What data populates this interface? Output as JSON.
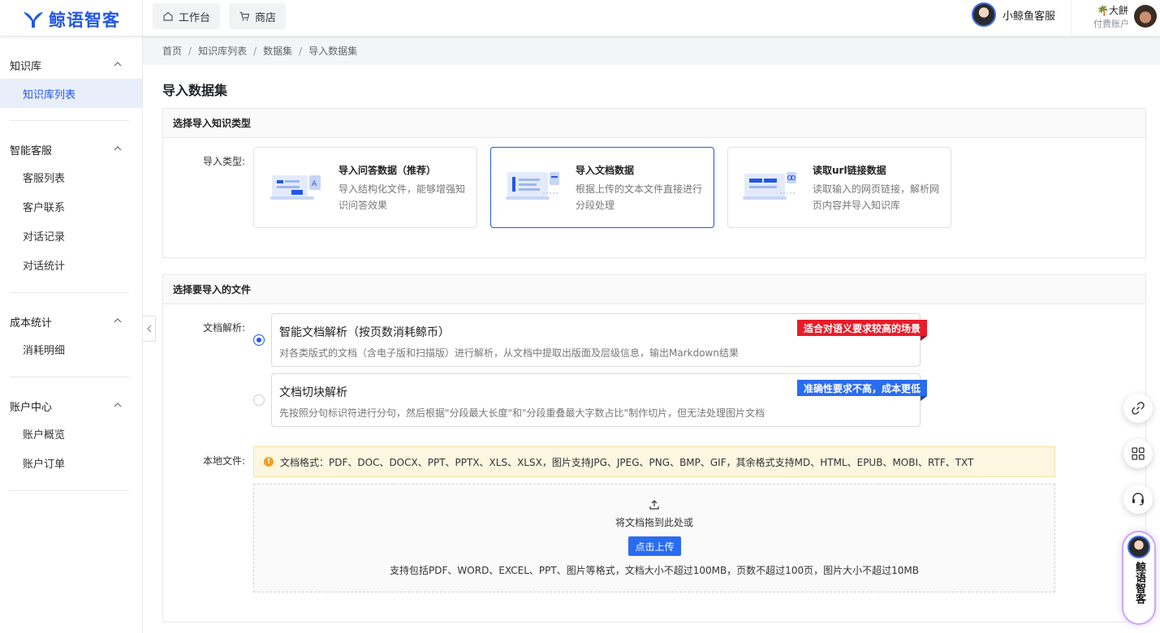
{
  "header": {
    "logo_text": "鲸语智客",
    "nav": [
      {
        "label": "工作台",
        "icon": "home-icon"
      },
      {
        "label": "商店",
        "icon": "cart-icon"
      }
    ],
    "customer_service": "小鲸鱼客服",
    "user": {
      "name": "🌴大餅",
      "tier": "付费账户"
    }
  },
  "sidebar": {
    "sections": [
      {
        "title": "知识库",
        "items": [
          "知识库列表"
        ]
      },
      {
        "title": "智能客服",
        "items": [
          "客服列表",
          "客户联系",
          "对话记录",
          "对话统计"
        ]
      },
      {
        "title": "成本统计",
        "items": [
          "消耗明细"
        ]
      },
      {
        "title": "账户中心",
        "items": [
          "账户概览",
          "账户订单"
        ]
      }
    ],
    "active_item": "知识库列表"
  },
  "breadcrumb": [
    "首页",
    "知识库列表",
    "数据集",
    "导入数据集"
  ],
  "page_title": "导入数据集",
  "import_type": {
    "section_title": "选择导入知识类型",
    "label": "导入类型:",
    "cards": [
      {
        "title": "导入问答数据（推荐）",
        "desc": "导入结构化文件，能够增强知识问答效果",
        "icon": "qa-data-icon",
        "selected": false
      },
      {
        "title": "导入文档数据",
        "desc": "根据上传的文本文件直接进行分段处理",
        "icon": "document-data-icon",
        "selected": true
      },
      {
        "title": "读取url链接数据",
        "desc": "读取输入的网页链接，解析网页内容并导入知识库",
        "icon": "url-link-icon",
        "selected": false
      }
    ]
  },
  "file_section": {
    "section_title": "选择要导入的文件",
    "parse_label": "文档解析:",
    "options": [
      {
        "title": "智能文档解析（按页数消耗鲸币）",
        "desc": "对各类版式的文档（含电子版和扫描版）进行解析，从文档中提取出版面及层级信息，输出Markdown结果",
        "tag": "适合对语义要求较高的场景",
        "tag_color": "#e81c2a",
        "selected": true
      },
      {
        "title": "文档切块解析",
        "desc": "先按照分句标识符进行分句，然后根据\"分段最大长度\"和\"分段重叠最大字数占比\"制作切片，但无法处理图片文档",
        "tag": "准确性要求不高，成本更低",
        "tag_color": "#2a6cf0",
        "selected": false
      }
    ],
    "local_label": "本地文件:",
    "notice": "文档格式：PDF、DOC、DOCX、PPT、PPTX、XLS、XLSX，图片支持JPG、JPEG、PNG、BMP、GIF，其余格式支持MD、HTML、EPUB、MOBI、RTF、TXT",
    "dropzone": {
      "text": "将文档拖到此处或",
      "button": "点击上传",
      "hint": "支持包括PDF、WORD、EXCEL、PPT、图片等格式，文档大小不超过100MB，页数不超过100页，图片大小不超过10MB"
    }
  },
  "floating": {
    "buttons": [
      "link-icon",
      "grid-icon",
      "headset-icon"
    ],
    "brand_text": "鲸语智客"
  },
  "colors": {
    "accent": "#2257e8",
    "tag_red": "#e81c2a",
    "tag_blue": "#2a6cf0"
  }
}
